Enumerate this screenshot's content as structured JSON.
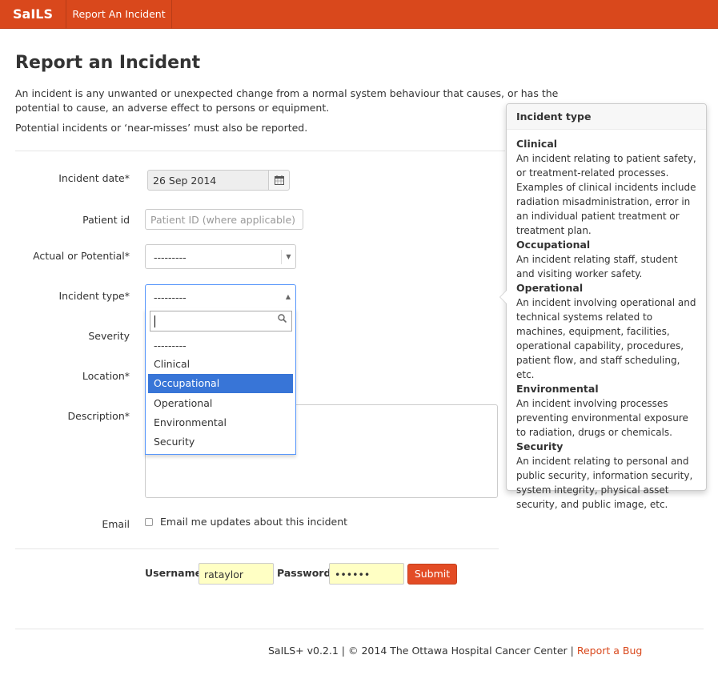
{
  "nav": {
    "brand": "SaILS",
    "link": "Report An Incident"
  },
  "page": {
    "title": "Report an Incident",
    "intro": "An incident is any unwanted or unexpected change from a normal system behaviour that causes, or has the potential to cause, an adverse effect to persons or equipment.",
    "intro2": "Potential incidents or ‘near-misses’ must also be reported."
  },
  "form": {
    "incident_date": {
      "label": "Incident date*",
      "value": "26 Sep 2014",
      "icon": "calendar-icon"
    },
    "patient_id": {
      "label": "Patient id",
      "placeholder": "Patient ID (where applicable)"
    },
    "actual_potential": {
      "label": "Actual or Potential*",
      "value": "---------"
    },
    "incident_type": {
      "label": "Incident type*",
      "value": "---------",
      "search": ""
    },
    "severity": {
      "label": "Severity"
    },
    "location": {
      "label": "Location*"
    },
    "description": {
      "label": "Description*"
    },
    "email": {
      "label": "Email",
      "checkbox_label": "Email me updates about this incident",
      "checked": false
    },
    "username": {
      "label": "Username",
      "value": "rataylor"
    },
    "password": {
      "label": "Password",
      "value": "••••••"
    },
    "submit": "Submit"
  },
  "dropdown": {
    "options": [
      "---------",
      "Clinical",
      "Occupational",
      "Operational",
      "Environmental",
      "Security"
    ],
    "highlighted": "Occupational"
  },
  "popover": {
    "title": "Incident type",
    "items": [
      {
        "heading": "Clinical",
        "text": "An incident relating to patient safety, or treatment-related processes. Examples of clinical incidents include radiation misadministration, error in an individual patient treatment or treatment plan."
      },
      {
        "heading": "Occupational",
        "text": "An incident relating staff, student and visiting worker safety."
      },
      {
        "heading": "Operational",
        "text": "An incident involving operational and technical systems related to machines, equipment, facilities, operational capability, procedures, patient flow, and staff scheduling, etc."
      },
      {
        "heading": "Environmental",
        "text": "An incident involving processes preventing environmental exposure to radiation, drugs or chemicals."
      },
      {
        "heading": "Security",
        "text": "An incident relating to personal and public security, information security, system integrity, physical asset security, and public image, etc."
      }
    ]
  },
  "footer": {
    "text": "SaILS+ v0.2.1 | © 2014 The Ottawa Hospital Cancer Center |",
    "link": "Report a Bug"
  },
  "colors": {
    "brand": "#d9481c",
    "submit": "#e34c25",
    "highlight": "#3875d7",
    "credential_bg": "#ffffc4"
  }
}
